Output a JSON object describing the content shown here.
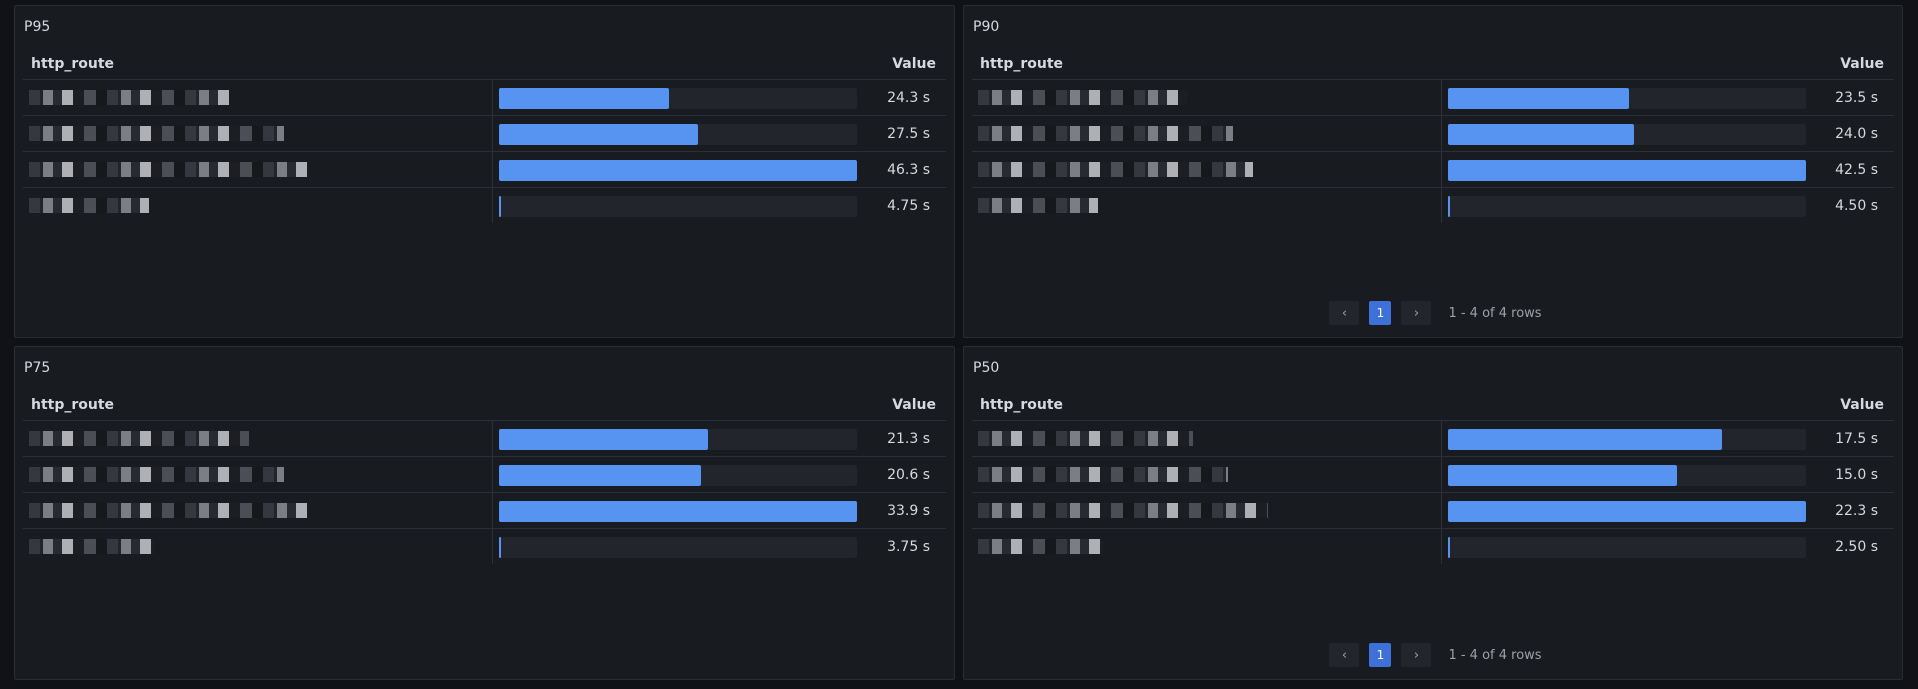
{
  "panels": [
    {
      "title": "P95",
      "col_route": "http_route",
      "col_value": "Value",
      "rows": [
        {
          "value": "24.3 s",
          "fraction": 0.475
        },
        {
          "value": "27.5 s",
          "fraction": 0.555
        },
        {
          "value": "46.3 s",
          "fraction": 1.0
        },
        {
          "value": "4.75 s",
          "fraction": 0.004
        }
      ],
      "show_pager": false
    },
    {
      "title": "P90",
      "col_route": "http_route",
      "col_value": "Value",
      "rows": [
        {
          "value": "23.5 s",
          "fraction": 0.505
        },
        {
          "value": "24.0 s",
          "fraction": 0.52
        },
        {
          "value": "42.5 s",
          "fraction": 1.0
        },
        {
          "value": "4.50 s",
          "fraction": 0.004
        }
      ],
      "show_pager": true,
      "pager": {
        "prev": "‹",
        "page": "1",
        "next": "›",
        "summary": "1 - 4 of 4 rows"
      }
    },
    {
      "title": "P75",
      "col_route": "http_route",
      "col_value": "Value",
      "rows": [
        {
          "value": "21.3 s",
          "fraction": 0.585
        },
        {
          "value": "20.6 s",
          "fraction": 0.565
        },
        {
          "value": "33.9 s",
          "fraction": 1.0
        },
        {
          "value": "3.75 s",
          "fraction": 0.004
        }
      ],
      "show_pager": false
    },
    {
      "title": "P50",
      "col_route": "http_route",
      "col_value": "Value",
      "rows": [
        {
          "value": "17.5 s",
          "fraction": 0.765
        },
        {
          "value": "15.0 s",
          "fraction": 0.64
        },
        {
          "value": "22.3 s",
          "fraction": 1.0
        },
        {
          "value": "2.50 s",
          "fraction": 0.004
        }
      ],
      "show_pager": true,
      "pager": {
        "prev": "‹",
        "page": "1",
        "next": "›",
        "summary": "1 - 4 of 4 rows"
      }
    }
  ],
  "colors": {
    "bar": "#5794f2",
    "track": "#22252b",
    "page_active": "#3d71d9",
    "panel_bg": "#181b1f",
    "page_bg": "#111217"
  }
}
